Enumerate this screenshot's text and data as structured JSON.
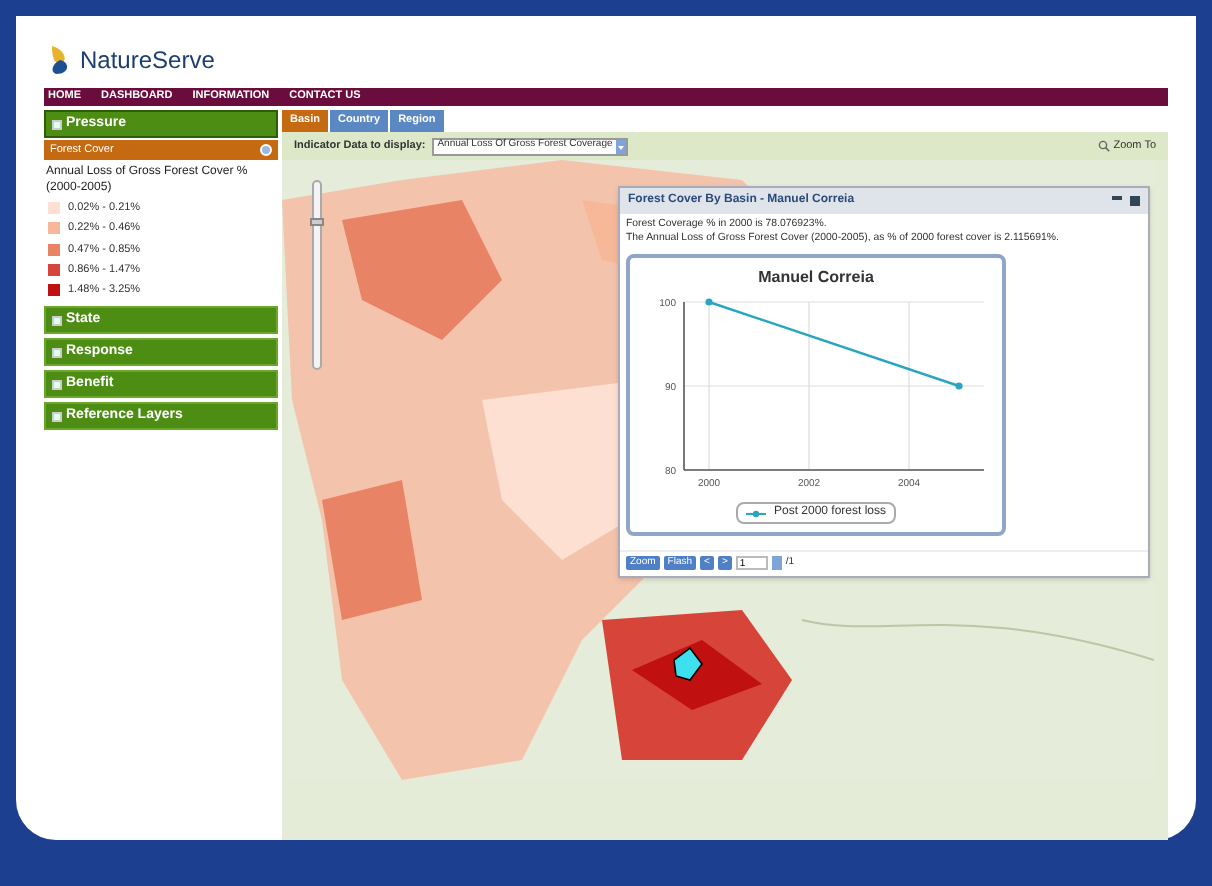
{
  "logo": {
    "text": "NatureServe"
  },
  "nav": [
    "HOME",
    "DASHBOARD",
    "INFORMATION",
    "CONTACT US"
  ],
  "sidebar": {
    "sections": [
      {
        "label": "Pressure",
        "expanded": true,
        "children": [
          {
            "label": "Forest Cover",
            "legend_title": "Annual Loss of Gross Forest Cover % (2000-2005)",
            "legend": [
              {
                "label": "0.02% - 0.21%",
                "color": "#fde0d2"
              },
              {
                "label": "0.22% - 0.46%",
                "color": "#f7b89a"
              },
              {
                "label": "0.47% - 0.85%",
                "color": "#e98366"
              },
              {
                "label": "0.86% - 1.47%",
                "color": "#d7453a"
              },
              {
                "label": "1.48% - 3.25%",
                "color": "#c0100f"
              }
            ]
          }
        ]
      },
      {
        "label": "State",
        "expanded": false
      },
      {
        "label": "Response",
        "expanded": false
      },
      {
        "label": "Benefit",
        "expanded": false
      },
      {
        "label": "Reference Layers",
        "expanded": false
      }
    ]
  },
  "tabs": [
    {
      "label": "Basin",
      "selected": true
    },
    {
      "label": "Country",
      "selected": false
    },
    {
      "label": "Region",
      "selected": false
    }
  ],
  "indicator": {
    "label": "Indicator Data to display:",
    "value": "Annual Loss Of Gross Forest Coverage",
    "zoom_to": "Zoom To"
  },
  "map_zoom": {
    "level": 0.8
  },
  "popup": {
    "title": "Forest Cover By Basin - Manuel Correia",
    "lines": [
      "Forest Coverage % in 2000 is 78.076923%.",
      "The Annual Loss of Gross Forest Cover (2000-2005), as % of 2000 forest cover is 2.115691%."
    ],
    "chart_data": {
      "type": "line",
      "grid": true,
      "title": "Manuel Correia",
      "x": [
        2000,
        2005
      ],
      "series": [
        {
          "name": "Post 2000 forest loss",
          "color": "#2aa5c0",
          "marker": true,
          "values": [
            100,
            90
          ]
        }
      ],
      "xlim": [
        1999.5,
        2005.5
      ],
      "ylim": [
        80,
        100
      ],
      "xticks": [
        2000,
        2002,
        2004
      ],
      "yticks": [
        80,
        90,
        100
      ]
    },
    "buttons": [
      "Zoom",
      "Flash",
      "<",
      ">"
    ],
    "page": "1",
    "page_total": "/1"
  }
}
